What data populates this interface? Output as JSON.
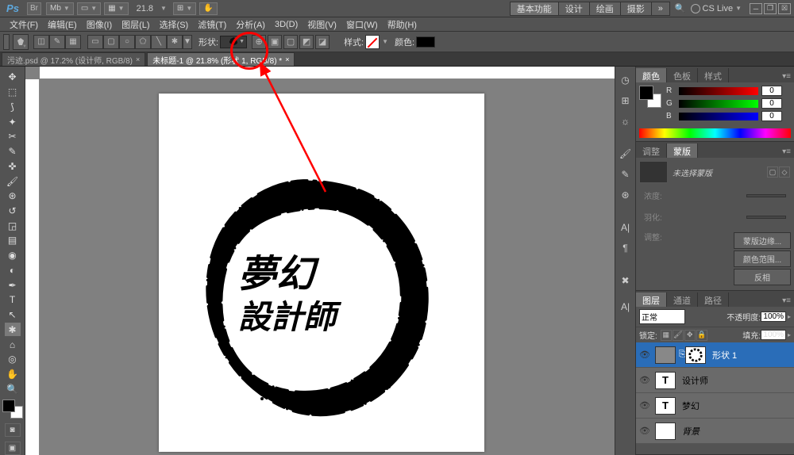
{
  "app": {
    "logo": "Ps",
    "zoom": "21.8",
    "cslive": "CS Live"
  },
  "workspaces": {
    "basic": "基本功能",
    "design": "设计",
    "paint": "绘画",
    "photo": "摄影"
  },
  "window_buttons": {
    "min": "─",
    "restore": "❐",
    "close": "☒"
  },
  "menu": {
    "file": "文件(F)",
    "edit": "编辑(E)",
    "image": "图像(I)",
    "layer": "图层(L)",
    "select": "选择(S)",
    "filter": "滤镜(T)",
    "analysis": "分析(A)",
    "threeD": "3D(D)",
    "view": "视图(V)",
    "window": "窗口(W)",
    "help": "帮助(H)"
  },
  "options": {
    "shape_label": "形状:",
    "style_label": "样式:",
    "color_label": "颜色:"
  },
  "documents": {
    "tab1": "污迹.psd @ 17.2% (设计师, RGB/8)",
    "tab2": "未标题-1 @ 21.8% (形状 1, RGB/8) *"
  },
  "canvas": {
    "line1": "夢幻",
    "line2": "   設計師"
  },
  "color_panel": {
    "tab_color": "颜色",
    "tab_swatch": "色板",
    "tab_style": "样式",
    "r_label": "R",
    "g_label": "G",
    "b_label": "B",
    "r_val": "0",
    "g_val": "0",
    "b_val": "0"
  },
  "mask_panel": {
    "tab_adjust": "调整",
    "tab_mask": "蒙版",
    "no_mask": "未选择蒙版",
    "density": "浓度:",
    "feather": "羽化:",
    "adjust": "调整:",
    "edge": "蒙版边缘...",
    "colorrange": "颜色范围...",
    "invert": "反相"
  },
  "layers_panel": {
    "tab_layers": "图层",
    "tab_channels": "通道",
    "tab_paths": "路径",
    "blend_mode": "正常",
    "opacity_label": "不透明度:",
    "opacity_val": "100%",
    "lock_label": "锁定:",
    "fill_label": "填充:",
    "fill_val": "100%",
    "layer_shape": "形状 1",
    "layer_designer": "设计师",
    "layer_dream": "梦幻",
    "layer_bg": "背景"
  }
}
